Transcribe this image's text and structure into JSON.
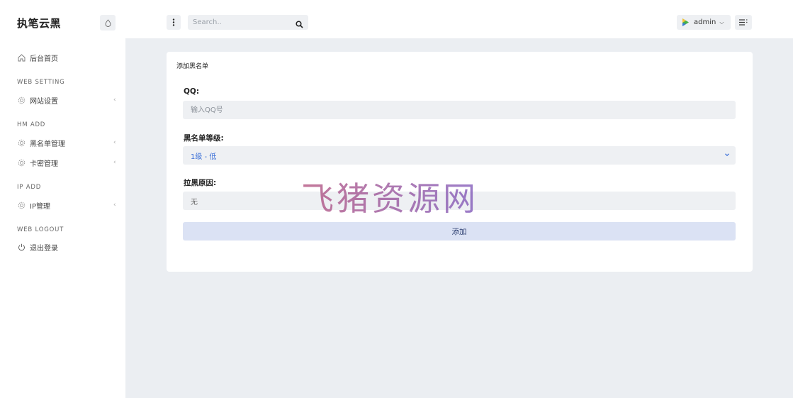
{
  "sidebar": {
    "brand": "执笔云黑",
    "home": "后台首页",
    "sections": [
      {
        "title": "WEB SETTING",
        "items": [
          {
            "label": "网站设置",
            "icon": "gear-icon"
          }
        ]
      },
      {
        "title": "HM ADD",
        "items": [
          {
            "label": "黑名单管理",
            "icon": "gear-icon"
          },
          {
            "label": "卡密管理",
            "icon": "gear-icon"
          }
        ]
      },
      {
        "title": "IP ADD",
        "items": [
          {
            "label": "IP管理",
            "icon": "gear-icon"
          }
        ]
      },
      {
        "title": "WEB LOGOUT",
        "items": [
          {
            "label": "退出登录",
            "icon": "power-icon"
          }
        ]
      }
    ]
  },
  "header": {
    "search_placeholder": "Search..",
    "username": "admin"
  },
  "form": {
    "title": "添加黑名单",
    "qq_label": "QQ:",
    "qq_placeholder": "输入QQ号",
    "level_label": "黑名单等级:",
    "level_selected": "1级 - 低",
    "reason_label": "拉黑原因:",
    "reason_value": "无",
    "submit_label": "添加"
  },
  "watermark": "飞猪资源网",
  "colors": {
    "accent": "#3a6fd8",
    "button_bg": "#dbe2f4",
    "field_bg": "#eef0f3",
    "page_bg": "#ebeef2"
  }
}
